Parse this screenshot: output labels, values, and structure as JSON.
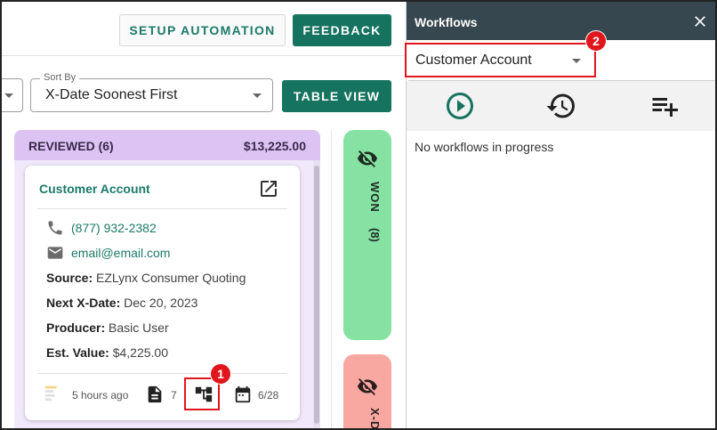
{
  "header": {
    "setup_label": "SETUP AUTOMATION",
    "feedback_label": "FEEDBACK"
  },
  "sort": {
    "legend": "Sort By",
    "value": "X-Date Soonest First"
  },
  "table_view_label": "TABLE VIEW",
  "column_reviewed": {
    "title": "REVIEWED (6)",
    "total": "$13,225.00",
    "color": "#dcc3f4"
  },
  "card": {
    "name": "Customer Account",
    "phone": "(877) 932-2382",
    "email": "email@email.com",
    "source_label": "Source:",
    "source_value": "EZLynx Consumer Quoting",
    "xdate_label": "Next X-Date:",
    "xdate_value": "Dec 20, 2023",
    "producer_label": "Producer:",
    "producer_value": "Basic User",
    "value_label": "Est. Value:",
    "value_value": "$4,225.00",
    "footer": {
      "time": "5 hours ago",
      "docs_count": "7",
      "date": "6/28"
    }
  },
  "column_won": {
    "label": "WON",
    "count": "(8)",
    "color": "#86e2a2"
  },
  "column_xdate": {
    "label": "X-D",
    "color": "#f8a8a0"
  },
  "panel": {
    "title": "Workflows",
    "select_value": "Customer Account",
    "empty_text": "No workflows in progress",
    "icons": [
      "play-circle-icon",
      "history-icon",
      "playlist-add-icon"
    ]
  },
  "callouts": {
    "one": "1",
    "two": "2",
    "color": "#e0161c"
  },
  "colors": {
    "brand": "#15735f",
    "panel_header": "#37474f"
  }
}
